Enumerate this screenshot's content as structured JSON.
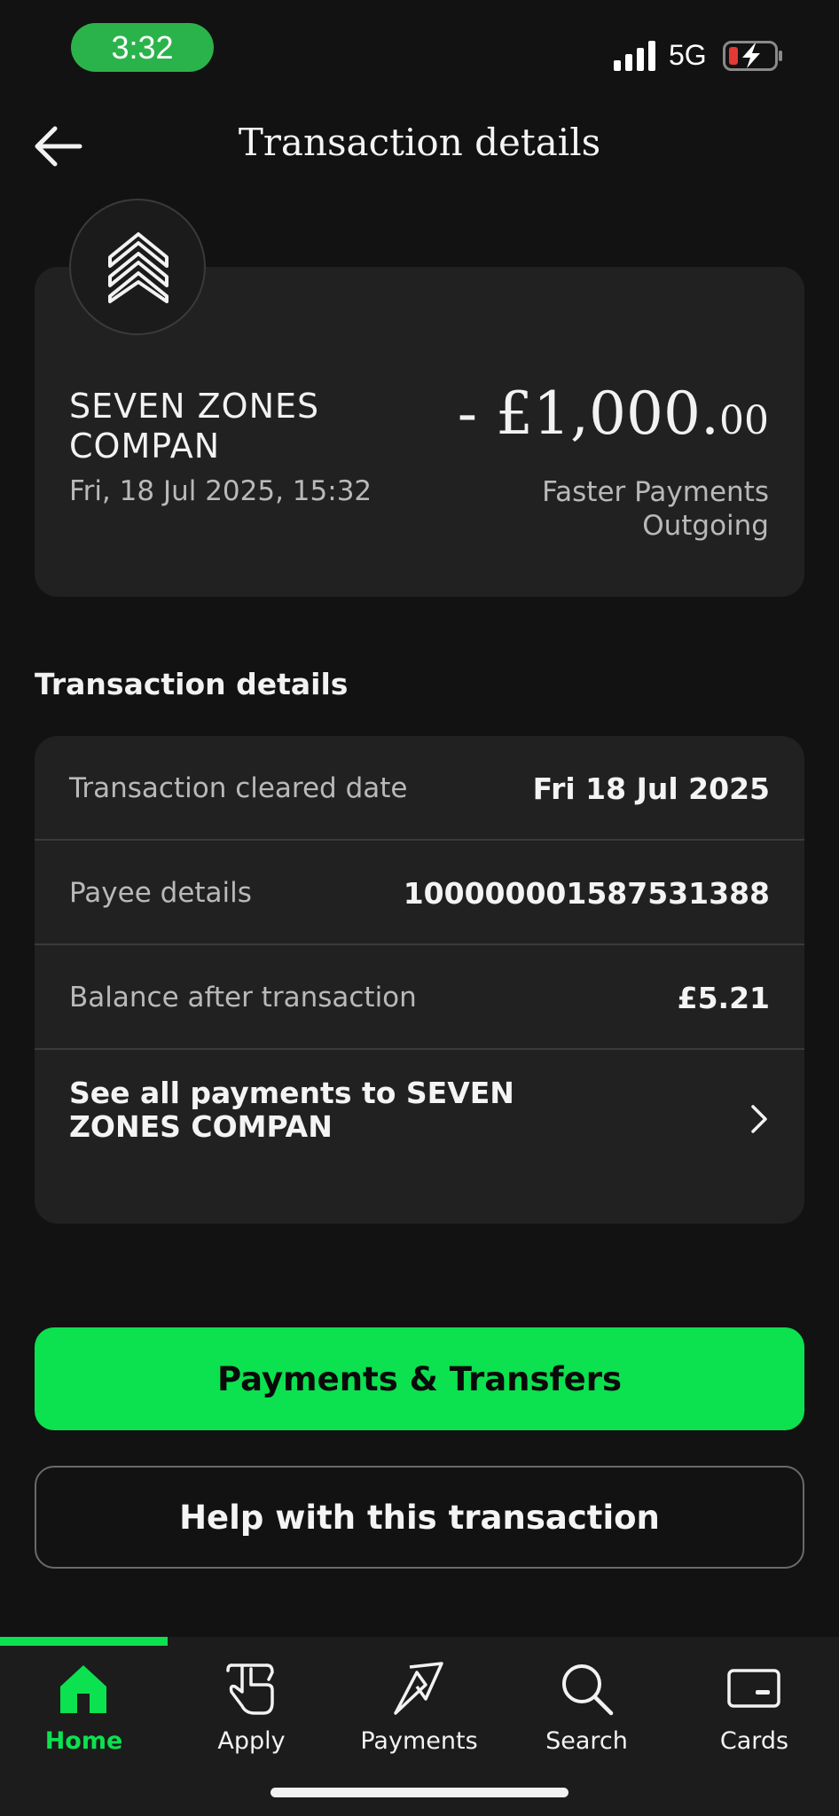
{
  "status_bar": {
    "time": "3:32",
    "network": "5G",
    "battery_state": "charging-low"
  },
  "header": {
    "title": "Transaction details"
  },
  "summary": {
    "payee_name": "SEVEN ZONES COMPAN",
    "date_time": "Fri, 18 Jul 2025, 15:32",
    "amount_main": "- £1,000.",
    "amount_decimals": "00",
    "payment_type": "Faster Payments Outgoing"
  },
  "details_section": {
    "title": "Transaction details",
    "rows": [
      {
        "label": "Transaction cleared date",
        "value": "Fri 18 Jul 2025"
      },
      {
        "label": "Payee details",
        "value": "100000001587531388"
      },
      {
        "label": "Balance after transaction",
        "value": "£5.21"
      }
    ],
    "see_all_label": "See all payments to SEVEN ZONES COMPAN"
  },
  "buttons": {
    "primary": "Payments & Transfers",
    "secondary": "Help with this transaction"
  },
  "tabbar": {
    "tabs": [
      {
        "label": "Home",
        "icon": "home-icon",
        "active": true
      },
      {
        "label": "Apply",
        "icon": "apply-hand-icon",
        "active": false
      },
      {
        "label": "Payments",
        "icon": "payments-icon",
        "active": false
      },
      {
        "label": "Search",
        "icon": "search-icon",
        "active": false
      },
      {
        "label": "Cards",
        "icon": "card-icon",
        "active": false
      }
    ]
  },
  "colors": {
    "background": "#121212",
    "card": "#212121",
    "accent_green": "#0ce150",
    "time_pill": "#2bb34b",
    "battery_low": "#e53935"
  }
}
